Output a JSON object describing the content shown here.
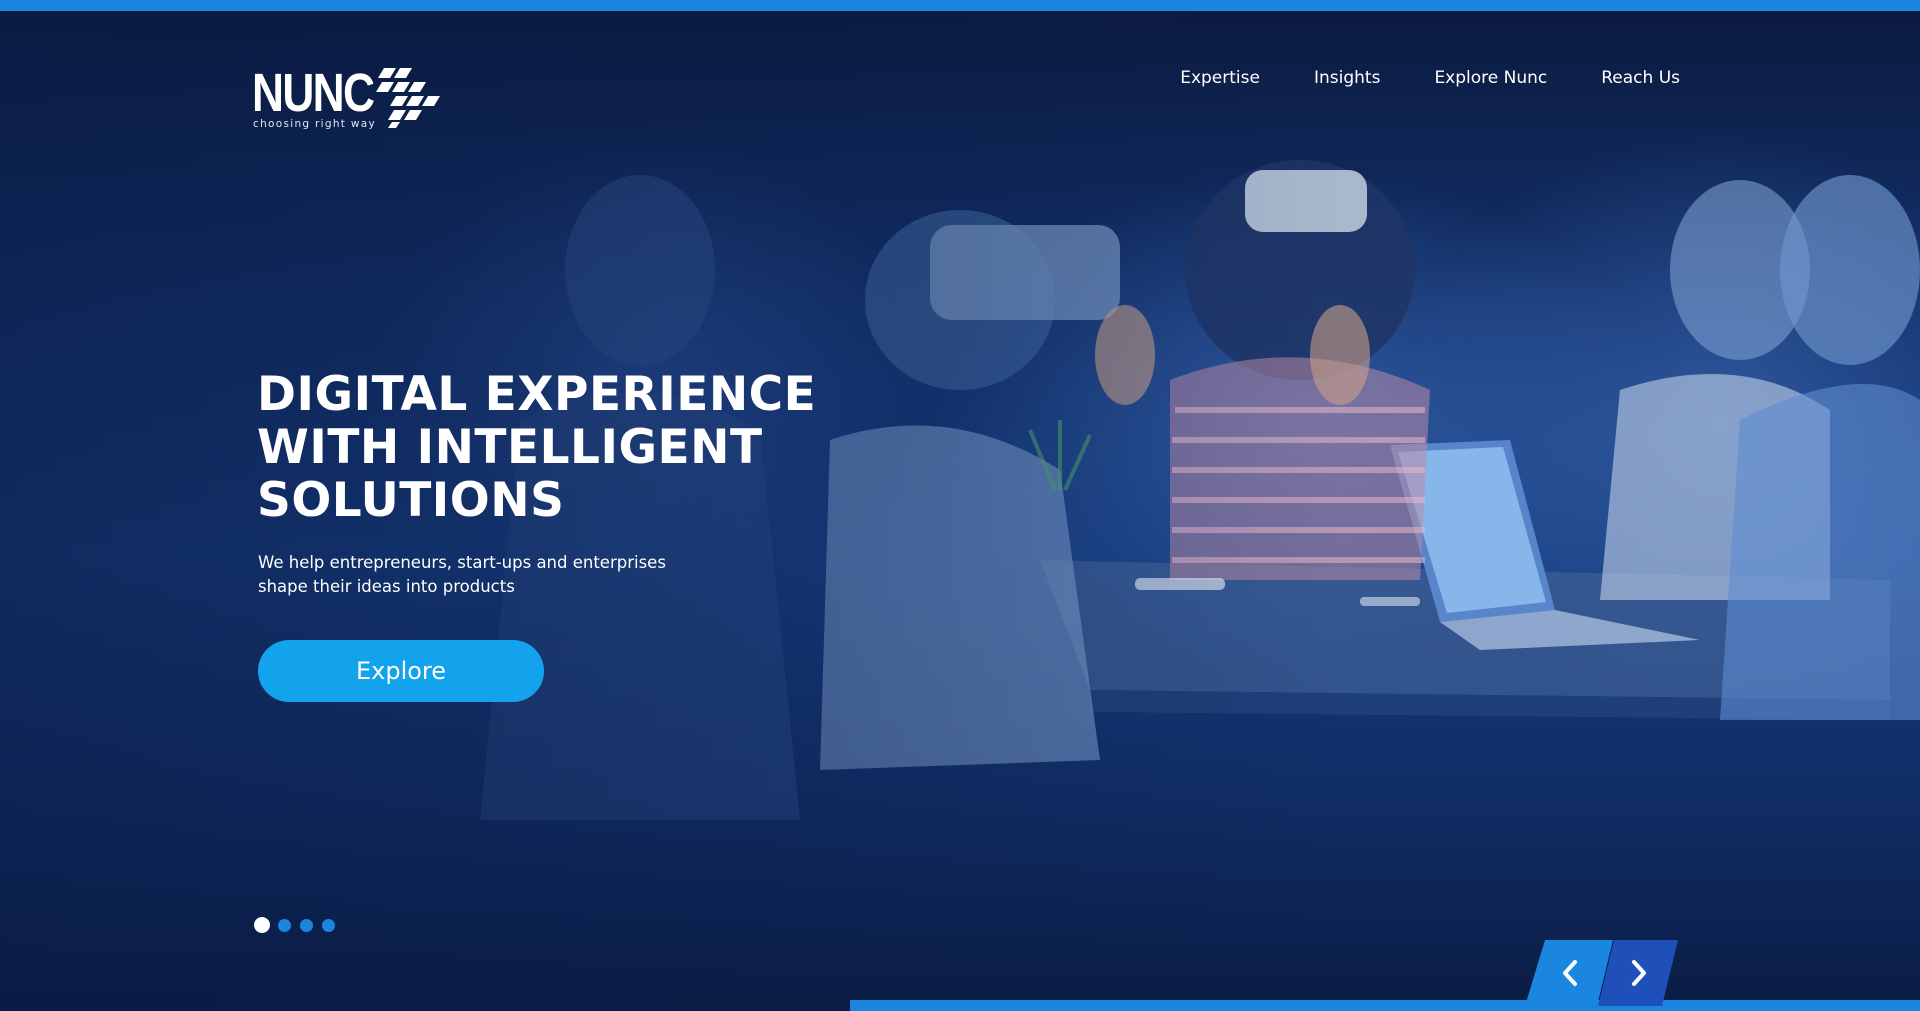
{
  "brand": {
    "name": "NUNC",
    "tagline": "choosing right way"
  },
  "nav": {
    "items": [
      {
        "label": "Expertise"
      },
      {
        "label": "Insights"
      },
      {
        "label": "Explore Nunc"
      },
      {
        "label": "Reach Us"
      }
    ]
  },
  "hero": {
    "title_line1": "DIGITAL EXPERIENCE",
    "title_line2": "WITH INTELLIGENT",
    "title_line3": "SOLUTIONS",
    "subtitle_line1": "We help entrepreneurs, start-ups and enterprises",
    "subtitle_line2": "shape their ideas into products",
    "cta_label": "Explore"
  },
  "slider": {
    "slide_count": 4,
    "active_index": 0
  },
  "icons": {
    "logo": "nunc-logo-mark",
    "prev": "chevron-left-icon",
    "next": "chevron-right-icon"
  },
  "colors": {
    "accent": "#1a86e0",
    "button": "#12a3ec",
    "background": "#0b1a3e",
    "arrow_prev": "#1a86e0",
    "arrow_next": "#1f4fb8"
  }
}
